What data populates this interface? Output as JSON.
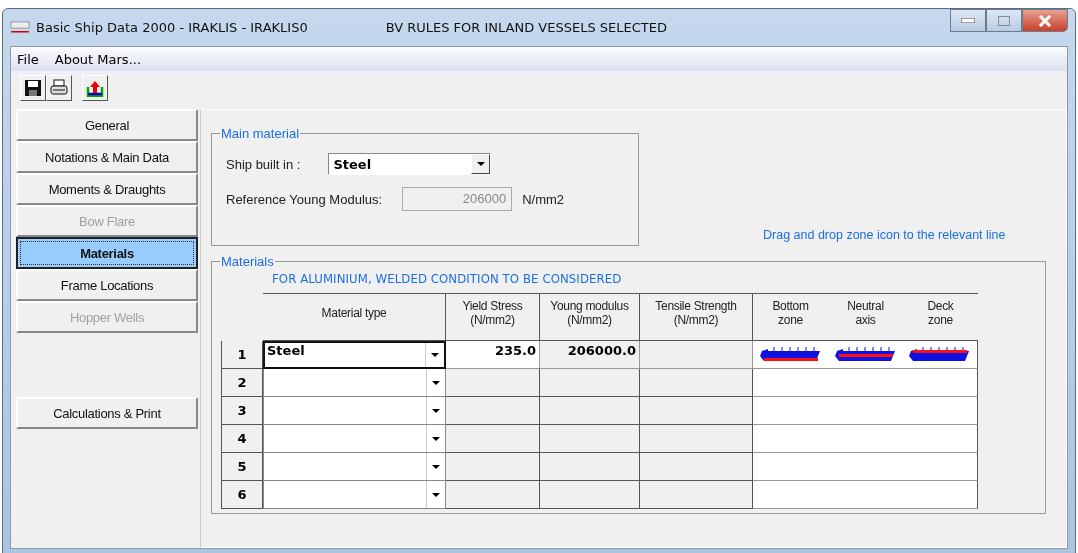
{
  "window": {
    "title": "Basic Ship Data 2000 - IRAKLIS - IRAKLIS0",
    "subtitle": "BV RULES FOR INLAND VESSELS SELECTED"
  },
  "menu": [
    "File",
    "About Mars..."
  ],
  "sidebar": {
    "items": [
      {
        "label": "General",
        "selected": false,
        "disabled": false
      },
      {
        "label": "Notations & Main Data",
        "selected": false,
        "disabled": false
      },
      {
        "label": "Moments & Draughts",
        "selected": false,
        "disabled": false
      },
      {
        "label": "Bow Flare",
        "selected": false,
        "disabled": true
      },
      {
        "label": "Materials",
        "selected": true,
        "disabled": false
      },
      {
        "label": "Frame Locations",
        "selected": false,
        "disabled": false
      },
      {
        "label": "Hopper Wells",
        "selected": false,
        "disabled": true
      }
    ],
    "bottom_button": "Calculations & Print"
  },
  "main_material": {
    "title": "Main material",
    "ship_built_in_label": "Ship built in :",
    "ship_built_in_value": "Steel",
    "young_label": "Reference Young Modulus:",
    "young_value": "206000",
    "young_unit": "N/mm2"
  },
  "hint": "Drag and drop zone icon to the relevant line",
  "materials": {
    "title": "Materials",
    "note": "FOR ALUMINIUM, WELDED CONDITION TO BE CONSIDERED",
    "columns": [
      "Material type",
      "Yield Stress (N/mm2)",
      "Young modulus (N/mm2)",
      "Tensile Strength (N/mm2)",
      "Bottom zone",
      "Neutral axis",
      "Deck zone"
    ],
    "rows": [
      {
        "number": "1",
        "material": "Steel",
        "yield": "235.0",
        "young": "206000.0",
        "selected": true,
        "zones": [
          {
            "kind": "bottom"
          },
          {
            "kind": "neutral"
          },
          {
            "kind": "deck"
          }
        ]
      },
      {
        "number": "2",
        "selected": false
      },
      {
        "number": "3",
        "selected": false
      },
      {
        "number": "4",
        "selected": false
      },
      {
        "number": "5",
        "selected": false
      },
      {
        "number": "6",
        "selected": false
      }
    ]
  }
}
